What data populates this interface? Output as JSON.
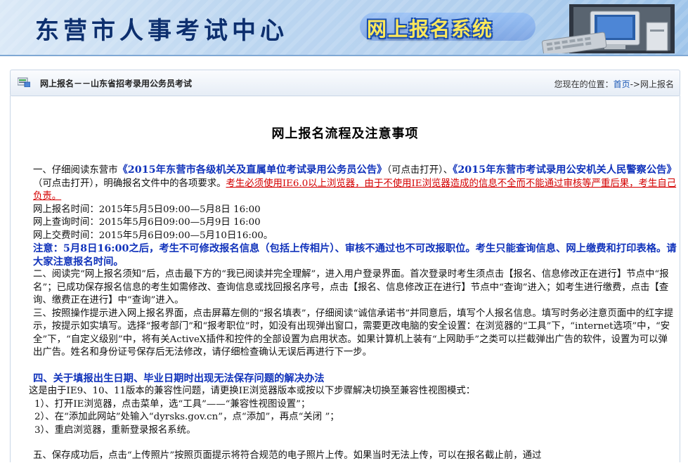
{
  "header": {
    "site_title": "东营市人事考试中心",
    "system_title": "网上报名系统"
  },
  "breadcrumb": {
    "section": "网上报名－－山东省招考录用公务员考试",
    "location_prefix": "您现在的位置：",
    "home_link": "首页",
    "separator": "->",
    "current": "网上报名"
  },
  "main": {
    "title": "网上报名流程及注意事项",
    "p1_lead": "一、仔细阅读东营市",
    "p1_link1": "《2015年东营市各级机关及直属单位考试录用公务员公告》",
    "p1_mid1": "（可点击打开）、",
    "p1_link2": "《2015年东营市考试录用公安机关人民警察公告》",
    "p1_mid2": "（可点击打开），明确报名文件中的各项要求。",
    "p1_warning": "考生必须使用IE6.0以上浏览器，由于不使用IE浏览器造成的信息不全而不能通过审核等严重后果，考生自己负责。",
    "time_register": "网上报名时间：2015年5月5日09:00—5月8日 16:00",
    "time_query": "网上查询时间：2015年5月6日09:00—5月9日 16:00",
    "time_payment": "网上交费时间：2015年5月6日09:00—5月10日16:00。",
    "notice": "注意：5月8日16:00之后，考生不可修改报名信息（包括上传相片）、审核不通过也不可改报职位。考生只能查询信息、网上缴费和打印表格。请大家注意报名时间。",
    "p2": "二、阅读完“网上报名须知”后，点击最下方的“我已阅读并完全理解”，进入用户登录界面。首次登录时考生须点击【报名、信息修改正在进行】节点中“报名”；已成功保存报名信息的考生如需修改、查询信息或找回报名序号，点击【报名、信息修改正在进行】节点中“查询”进入；如考生进行缴费，点击【查询、缴费正在进行】中“查询”进入。",
    "p3": "三、按照操作提示进入网上报名界面，点击屏幕左侧的“报名填表”，仔细阅读“诚信承诺书”并同意后，填写个人报名信息。填写时务必注意页面中的红字提示，按提示如实填写。选择“报考部门”和“报考职位”时，如没有出现弹出窗口，需要更改电脑的安全设置：在浏览器的“工具”下，“internet选项”中，“安全”下，“自定义级别”中，将有关ActiveX插件和控件的全部设置为启用状态。如果计算机上装有“上网助手”之类可以拦截弹出广告的软件，设置为可以弹出广告。姓名和身份证号保存后无法修改，请仔细检查确认无误后再进行下一步。",
    "section4_title": "四、关于填报出生日期、毕业日期时出现无法保存问题的解决办法",
    "s4_intro": "这是由于IE9、10、11版本的兼容性问题，请更换IE浏览器版本或按以下步骤解决切换至兼容性视图模式：",
    "s4_step1": "1）、打开IE浏览器，点击菜单，选“工具”——“兼容性视图设置”；",
    "s4_step2": "2）、在“添加此网站”处输入“dyrsks.gov.cn”，点“添加”，再点“关闭 ”；",
    "s4_step3": "3）、重启浏览器，重新登录报名系统。",
    "p5_partial": "五、保存成功后，点击“上传照片”按照页面提示将符合规范的电子照片上传。如果当时无法上传，可以在报名截止前，通过"
  },
  "colors": {
    "link_blue": "#1133bb",
    "warning_red": "#d40000",
    "title_navy": "#0d2f6e",
    "banner_blue": "#b6d2ef"
  }
}
